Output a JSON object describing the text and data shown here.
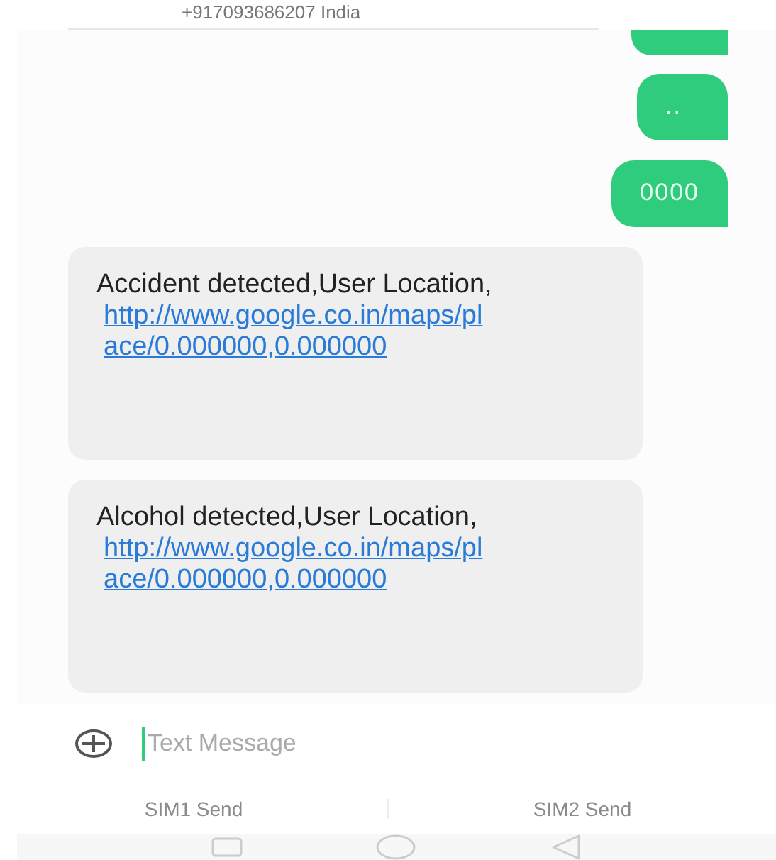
{
  "header": {
    "subtitle": "+917093686207  India"
  },
  "messages": [
    {
      "kind": "out",
      "text": ".."
    },
    {
      "kind": "out",
      "text": "0000"
    },
    {
      "kind": "in",
      "text": "Accident detected,User Location,",
      "link": "http://www.google.co.in/maps/place/0.000000,0.000000"
    },
    {
      "kind": "in",
      "text": "Alcohol detected,User Location,",
      "link": "http://www.google.co.in/maps/place/0.000000,0.000000"
    }
  ],
  "composer": {
    "placeholder": "Text Message"
  },
  "send_buttons": [
    "SIM1 Send",
    "SIM2 Send"
  ]
}
